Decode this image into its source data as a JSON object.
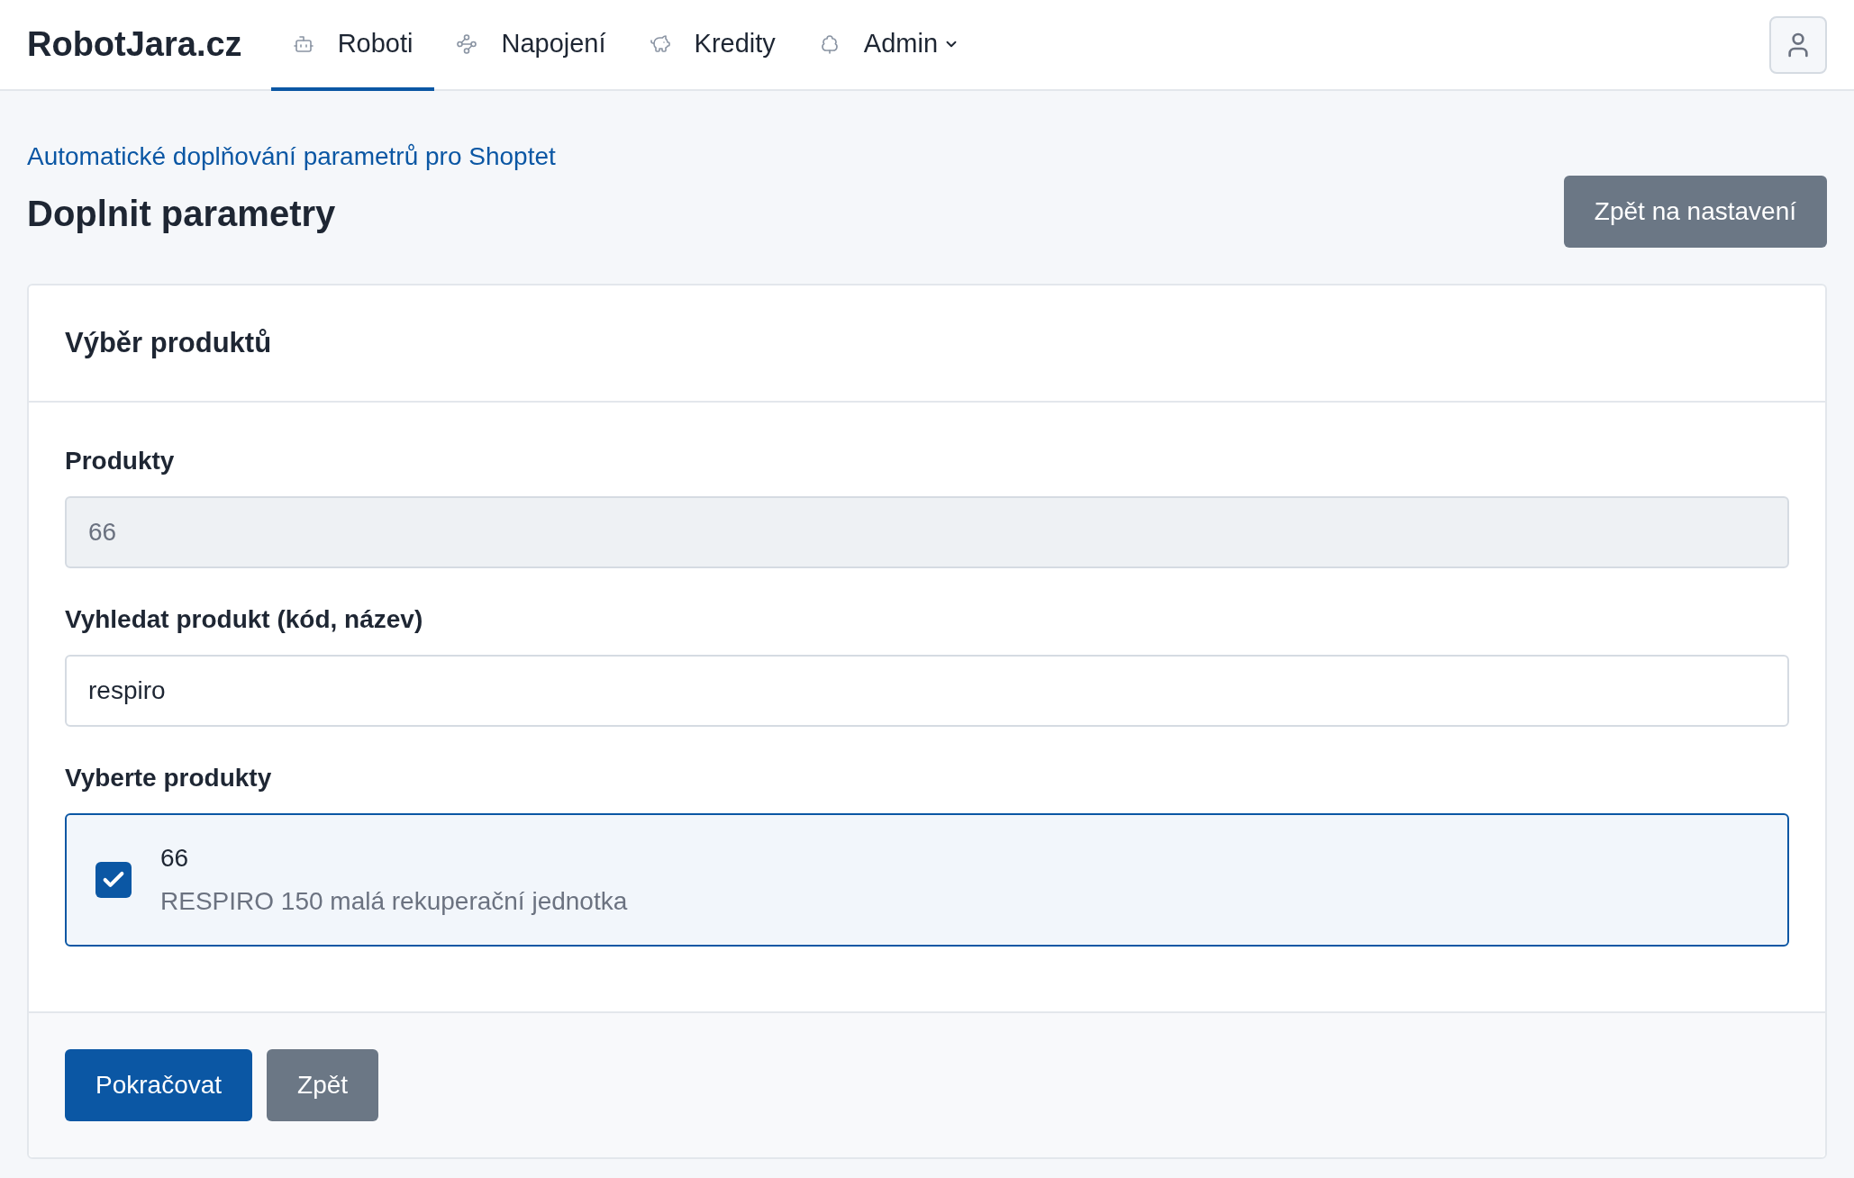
{
  "brand": "RobotJara.cz",
  "nav": [
    {
      "label": "Roboti",
      "selected": true,
      "dropdown": false
    },
    {
      "label": "Napojení",
      "selected": false,
      "dropdown": false
    },
    {
      "label": "Kredity",
      "selected": false,
      "dropdown": false
    },
    {
      "label": "Admin",
      "selected": false,
      "dropdown": true
    }
  ],
  "breadcrumb": "Automatické doplňování parametrů pro Shoptet",
  "title": "Doplnit parametry",
  "back_settings_button": "Zpět na nastavení",
  "card": {
    "title": "Výběr produktů",
    "products_label": "Produkty",
    "products_value": "66",
    "search_label": "Vyhledat produkt (kód, název)",
    "search_value": "respiro",
    "select_label": "Vyberte produkty",
    "items": [
      {
        "code": "66",
        "name": "RESPIRO 150 malá rekuperační jednotka",
        "checked": true
      }
    ],
    "buttons": [
      {
        "label": "Pokračovat",
        "kind": "primary"
      },
      {
        "label": "Zpět",
        "kind": "secondary"
      }
    ]
  }
}
